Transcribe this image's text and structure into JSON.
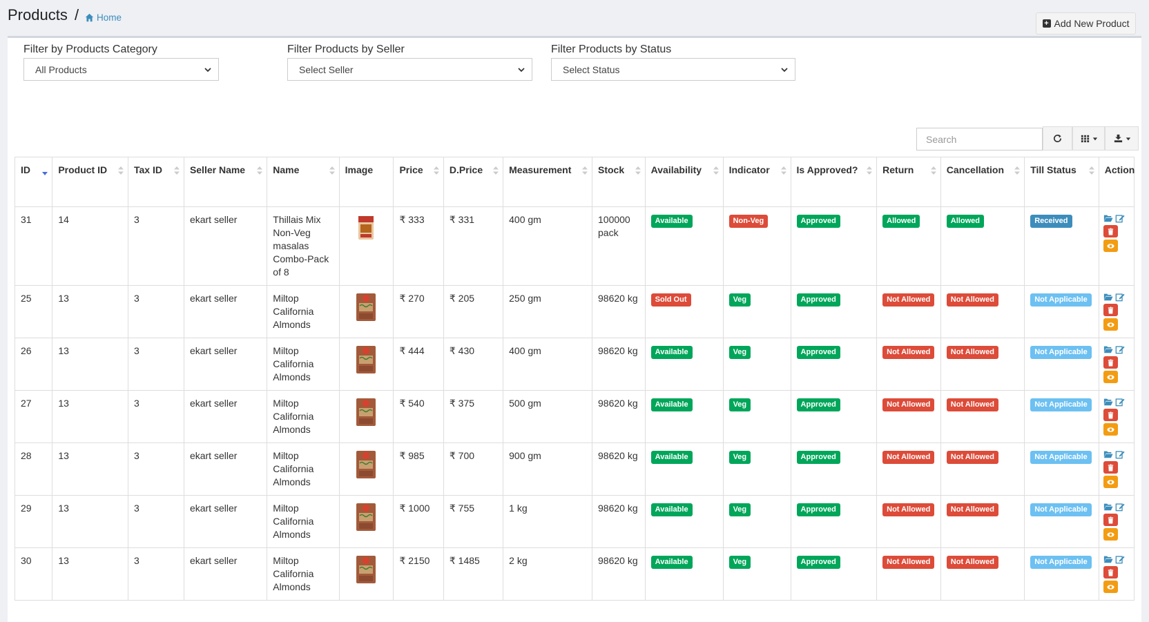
{
  "header": {
    "title": "Products",
    "separator": "/",
    "breadcrumb_home": "Home",
    "add_button": "Add New Product"
  },
  "filters": {
    "category": {
      "label": "Filter by Products Category",
      "value": "All Products"
    },
    "seller": {
      "label": "Filter Products by Seller",
      "value": "Select Seller"
    },
    "status": {
      "label": "Filter Products by Status",
      "value": "Select Status"
    }
  },
  "toolbar": {
    "search_placeholder": "Search"
  },
  "table": {
    "columns": [
      "ID",
      "Product ID",
      "Tax ID",
      "Seller Name",
      "Name",
      "Image",
      "Price",
      "D.Price",
      "Measurement",
      "Stock",
      "Availability",
      "Indicator",
      "Is Approved?",
      "Return",
      "Cancellation",
      "Till Status",
      "Action"
    ],
    "rows": [
      {
        "id": "31",
        "product_id": "14",
        "tax_id": "3",
        "seller": "ekart seller",
        "name": "Thillais Mix Non-Veg masalas Combo-Pack of 8",
        "price": "₹ 333",
        "dprice": "₹ 331",
        "measurement": "400 gm",
        "stock": "100000 pack",
        "availability": "Available",
        "indicator": "Non-Veg",
        "approved": "Approved",
        "return": "Allowed",
        "cancellation": "Allowed",
        "till_status": "Received"
      },
      {
        "id": "25",
        "product_id": "13",
        "tax_id": "3",
        "seller": "ekart seller",
        "name": "Miltop California Almonds",
        "price": "₹ 270",
        "dprice": "₹ 205",
        "measurement": "250 gm",
        "stock": "98620 kg",
        "availability": "Sold Out",
        "indicator": "Veg",
        "approved": "Approved",
        "return": "Not Allowed",
        "cancellation": "Not Allowed",
        "till_status": "Not Applicable"
      },
      {
        "id": "26",
        "product_id": "13",
        "tax_id": "3",
        "seller": "ekart seller",
        "name": "Miltop California Almonds",
        "price": "₹ 444",
        "dprice": "₹ 430",
        "measurement": "400 gm",
        "stock": "98620 kg",
        "availability": "Available",
        "indicator": "Veg",
        "approved": "Approved",
        "return": "Not Allowed",
        "cancellation": "Not Allowed",
        "till_status": "Not Applicable"
      },
      {
        "id": "27",
        "product_id": "13",
        "tax_id": "3",
        "seller": "ekart seller",
        "name": "Miltop California Almonds",
        "price": "₹ 540",
        "dprice": "₹ 375",
        "measurement": "500 gm",
        "stock": "98620 kg",
        "availability": "Available",
        "indicator": "Veg",
        "approved": "Approved",
        "return": "Not Allowed",
        "cancellation": "Not Allowed",
        "till_status": "Not Applicable"
      },
      {
        "id": "28",
        "product_id": "13",
        "tax_id": "3",
        "seller": "ekart seller",
        "name": "Miltop California Almonds",
        "price": "₹ 985",
        "dprice": "₹ 700",
        "measurement": "900 gm",
        "stock": "98620 kg",
        "availability": "Available",
        "indicator": "Veg",
        "approved": "Approved",
        "return": "Not Allowed",
        "cancellation": "Not Allowed",
        "till_status": "Not Applicable"
      },
      {
        "id": "29",
        "product_id": "13",
        "tax_id": "3",
        "seller": "ekart seller",
        "name": "Miltop California Almonds",
        "price": "₹ 1000",
        "dprice": "₹ 755",
        "measurement": "1 kg",
        "stock": "98620 kg",
        "availability": "Available",
        "indicator": "Veg",
        "approved": "Approved",
        "return": "Not Allowed",
        "cancellation": "Not Allowed",
        "till_status": "Not Applicable"
      },
      {
        "id": "30",
        "product_id": "13",
        "tax_id": "3",
        "seller": "ekart seller",
        "name": "Miltop California Almonds",
        "price": "₹ 2150",
        "dprice": "₹ 1485",
        "measurement": "2 kg",
        "stock": "98620 kg",
        "availability": "Available",
        "indicator": "Veg",
        "approved": "Approved",
        "return": "Not Allowed",
        "cancellation": "Not Allowed",
        "till_status": "Not Applicable"
      }
    ]
  },
  "icons": {
    "home": "home-icon",
    "add": "plus-square-icon",
    "refresh": "refresh-icon",
    "columns": "grid-columns-icon",
    "export": "export-icon",
    "open": "folder-open-icon",
    "edit": "edit-icon",
    "delete": "trash-icon",
    "view": "eye-icon"
  },
  "colors": {
    "green": "#00a65a",
    "red": "#dd4b39",
    "blue": "#3c8dbc",
    "light_blue": "#6cc0f2",
    "orange": "#f39c12",
    "link": "#3c8dbc"
  }
}
